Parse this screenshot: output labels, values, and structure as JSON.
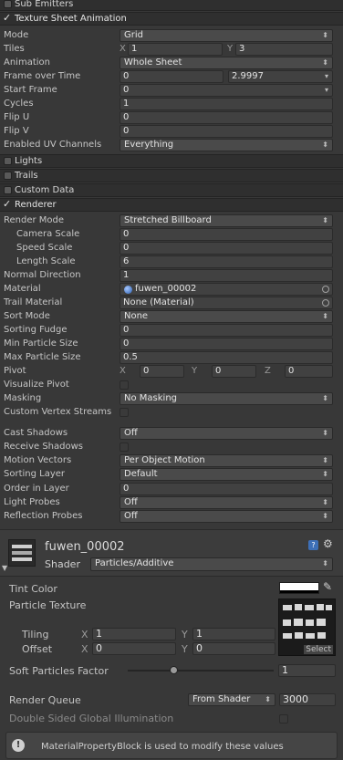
{
  "modules": {
    "sub_emitters": "Sub Emitters",
    "texture_sheet": "Texture Sheet Animation",
    "lights": "Lights",
    "trails": "Trails",
    "custom_data": "Custom Data",
    "renderer": "Renderer"
  },
  "texture_sheet": {
    "mode_label": "Mode",
    "mode_value": "Grid",
    "tiles_label": "Tiles",
    "tiles_x_axis": "X",
    "tiles_x": "1",
    "tiles_y_axis": "Y",
    "tiles_y": "3",
    "animation_label": "Animation",
    "animation_value": "Whole Sheet",
    "frame_over_time_label": "Frame over Time",
    "frame_over_time_min": "0",
    "frame_over_time_max": "2.9997",
    "start_frame_label": "Start Frame",
    "start_frame_value": "0",
    "cycles_label": "Cycles",
    "cycles_value": "1",
    "flip_u_label": "Flip U",
    "flip_u_value": "0",
    "flip_v_label": "Flip V",
    "flip_v_value": "0",
    "uv_channels_label": "Enabled UV Channels",
    "uv_channels_value": "Everything"
  },
  "renderer": {
    "render_mode_label": "Render Mode",
    "render_mode_value": "Stretched Billboard",
    "camera_scale_label": "Camera Scale",
    "camera_scale_value": "0",
    "speed_scale_label": "Speed Scale",
    "speed_scale_value": "0",
    "length_scale_label": "Length Scale",
    "length_scale_value": "6",
    "normal_direction_label": "Normal Direction",
    "normal_direction_value": "1",
    "material_label": "Material",
    "material_value": "fuwen_00002",
    "trail_material_label": "Trail Material",
    "trail_material_value": "None (Material)",
    "sort_mode_label": "Sort Mode",
    "sort_mode_value": "None",
    "sorting_fudge_label": "Sorting Fudge",
    "sorting_fudge_value": "0",
    "min_particle_label": "Min Particle Size",
    "min_particle_value": "0",
    "max_particle_label": "Max Particle Size",
    "max_particle_value": "0.5",
    "pivot_label": "Pivot",
    "pivot_x_axis": "X",
    "pivot_x": "0",
    "pivot_y_axis": "Y",
    "pivot_y": "0",
    "pivot_z_axis": "Z",
    "pivot_z": "0",
    "visualize_pivot_label": "Visualize Pivot",
    "masking_label": "Masking",
    "masking_value": "No Masking",
    "custom_vertex_label": "Custom Vertex Streams",
    "cast_shadows_label": "Cast Shadows",
    "cast_shadows_value": "Off",
    "receive_shadows_label": "Receive Shadows",
    "motion_vectors_label": "Motion Vectors",
    "motion_vectors_value": "Per Object Motion",
    "sorting_layer_label": "Sorting Layer",
    "sorting_layer_value": "Default",
    "order_in_layer_label": "Order in Layer",
    "order_in_layer_value": "0",
    "light_probes_label": "Light Probes",
    "light_probes_value": "Off",
    "reflection_probes_label": "Reflection Probes",
    "reflection_probes_value": "Off"
  },
  "material": {
    "name": "fuwen_00002",
    "shader_label": "Shader",
    "shader_value": "Particles/Additive",
    "tint_color_label": "Tint Color",
    "particle_texture_label": "Particle Texture",
    "select_label": "Select",
    "tiling_label": "Tiling",
    "tiling_x_axis": "X",
    "tiling_x": "1",
    "tiling_y_axis": "Y",
    "tiling_y": "1",
    "offset_label": "Offset",
    "offset_x_axis": "X",
    "offset_x": "0",
    "offset_y_axis": "Y",
    "offset_y": "0",
    "soft_particles_label": "Soft Particles Factor",
    "soft_particles_value": "1",
    "soft_particles_fraction": 0.32,
    "render_queue_label": "Render Queue",
    "render_queue_mode": "From Shader",
    "render_queue_value": "3000",
    "double_sided_gi_label": "Double Sided Global Illumination",
    "info_message": "MaterialPropertyBlock is used to modify these values"
  },
  "colors": {
    "background": "#383838",
    "header": "#2f2f2f",
    "field": "#414141",
    "text": "#c4c4c4"
  }
}
